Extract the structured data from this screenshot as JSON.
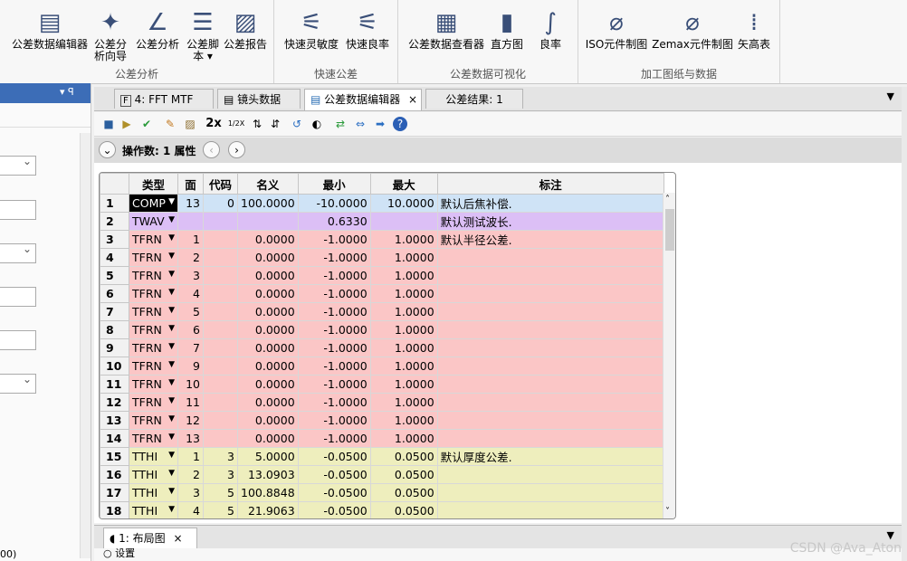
{
  "ribbon": {
    "groups": [
      {
        "label": "公差分析",
        "buttons": [
          "公差数据编辑器",
          "公差分析向导",
          "公差分析",
          "公差脚本 ▾",
          "公差报告"
        ],
        "icons": [
          "tolerance-editor-icon",
          "wizard-icon",
          "analysis-icon",
          "script-icon",
          "report-icon"
        ]
      },
      {
        "label": "快速公差",
        "buttons": [
          "快速灵敏度",
          "快速良率"
        ],
        "icons": [
          "quick-sensitivity-icon",
          "quick-yield-icon"
        ]
      },
      {
        "label": "公差数据可视化",
        "buttons": [
          "公差数据查看器",
          "直方图",
          "良率"
        ],
        "icons": [
          "data-viewer-icon",
          "histogram-icon",
          "yield-curve-icon"
        ]
      },
      {
        "label": "加工图纸与数据",
        "buttons": [
          "ISO元件制图",
          "Zemax元件制图",
          "矢高表"
        ],
        "icons": [
          "iso-drawing-icon",
          "zemax-drawing-icon",
          "sag-table-icon"
        ]
      }
    ]
  },
  "left_panel": {
    "pin_glyph": "▾ ꟼ",
    "status_text": "00)"
  },
  "tabs": [
    {
      "label": "4: FFT MTF",
      "icon": "F"
    },
    {
      "label": "镜头数据",
      "icon": "▤"
    },
    {
      "label": "公差数据编辑器",
      "icon": "▤",
      "active": true,
      "close": "×"
    },
    {
      "label": "公差结果: 1"
    }
  ],
  "toolbar": {
    "zoom_2x": "2x",
    "zoom_half": "1/2X"
  },
  "operand_bar": {
    "label": "操作数: 1 属性",
    "prev": "‹",
    "next": "›",
    "collapse": "⌄"
  },
  "table": {
    "headers": [
      "",
      "类型",
      "面",
      "代码",
      "名义",
      "最小",
      "最大",
      "标注"
    ],
    "rows": [
      {
        "n": "1",
        "type": "COMP",
        "surf": "13",
        "code": "0",
        "nominal": "100.0000",
        "min": "-10.0000",
        "max": "10.0000",
        "comment": "默认后焦补偿.",
        "color": "rb",
        "sel": true
      },
      {
        "n": "2",
        "type": "TWAV",
        "surf": "",
        "code": "",
        "nominal": "",
        "min": "0.6330",
        "max": "",
        "comment": "默认测试波长.",
        "color": "rp"
      },
      {
        "n": "3",
        "type": "TFRN",
        "surf": "1",
        "code": "",
        "nominal": "0.0000",
        "min": "-1.0000",
        "max": "1.0000",
        "comment": "默认半径公差.",
        "color": "rr"
      },
      {
        "n": "4",
        "type": "TFRN",
        "surf": "2",
        "code": "",
        "nominal": "0.0000",
        "min": "-1.0000",
        "max": "1.0000",
        "comment": "",
        "color": "rr"
      },
      {
        "n": "5",
        "type": "TFRN",
        "surf": "3",
        "code": "",
        "nominal": "0.0000",
        "min": "-1.0000",
        "max": "1.0000",
        "comment": "",
        "color": "rr"
      },
      {
        "n": "6",
        "type": "TFRN",
        "surf": "4",
        "code": "",
        "nominal": "0.0000",
        "min": "-1.0000",
        "max": "1.0000",
        "comment": "",
        "color": "rr"
      },
      {
        "n": "7",
        "type": "TFRN",
        "surf": "5",
        "code": "",
        "nominal": "0.0000",
        "min": "-1.0000",
        "max": "1.0000",
        "comment": "",
        "color": "rr"
      },
      {
        "n": "8",
        "type": "TFRN",
        "surf": "6",
        "code": "",
        "nominal": "0.0000",
        "min": "-1.0000",
        "max": "1.0000",
        "comment": "",
        "color": "rr"
      },
      {
        "n": "9",
        "type": "TFRN",
        "surf": "7",
        "code": "",
        "nominal": "0.0000",
        "min": "-1.0000",
        "max": "1.0000",
        "comment": "",
        "color": "rr"
      },
      {
        "n": "10",
        "type": "TFRN",
        "surf": "9",
        "code": "",
        "nominal": "0.0000",
        "min": "-1.0000",
        "max": "1.0000",
        "comment": "",
        "color": "rr"
      },
      {
        "n": "11",
        "type": "TFRN",
        "surf": "10",
        "code": "",
        "nominal": "0.0000",
        "min": "-1.0000",
        "max": "1.0000",
        "comment": "",
        "color": "rr"
      },
      {
        "n": "12",
        "type": "TFRN",
        "surf": "11",
        "code": "",
        "nominal": "0.0000",
        "min": "-1.0000",
        "max": "1.0000",
        "comment": "",
        "color": "rr"
      },
      {
        "n": "13",
        "type": "TFRN",
        "surf": "12",
        "code": "",
        "nominal": "0.0000",
        "min": "-1.0000",
        "max": "1.0000",
        "comment": "",
        "color": "rr"
      },
      {
        "n": "14",
        "type": "TFRN",
        "surf": "13",
        "code": "",
        "nominal": "0.0000",
        "min": "-1.0000",
        "max": "1.0000",
        "comment": "",
        "color": "rr"
      },
      {
        "n": "15",
        "type": "TTHI",
        "surf": "1",
        "code": "3",
        "nominal": "5.0000",
        "min": "-0.0500",
        "max": "0.0500",
        "comment": "默认厚度公差.",
        "color": "ry"
      },
      {
        "n": "16",
        "type": "TTHI",
        "surf": "2",
        "code": "3",
        "nominal": "13.0903",
        "min": "-0.0500",
        "max": "0.0500",
        "comment": "",
        "color": "ry"
      },
      {
        "n": "17",
        "type": "TTHI",
        "surf": "3",
        "code": "5",
        "nominal": "100.8848",
        "min": "-0.0500",
        "max": "0.0500",
        "comment": "",
        "color": "ry"
      },
      {
        "n": "18",
        "type": "TTHI",
        "surf": "4",
        "code": "5",
        "nominal": "21.9063",
        "min": "-0.0500",
        "max": "0.0500",
        "comment": "",
        "color": "ry"
      }
    ]
  },
  "bottom_tabs": [
    {
      "label": "1: 布局图",
      "close": "×"
    }
  ],
  "bottom_toolbar": {
    "settings_label": "设置"
  },
  "watermark": "CSDN @Ava_Aton",
  "colors": {
    "comp": "#cfe3f6",
    "twav": "#dcbff6",
    "tfrn": "#fbc6c6",
    "tthi": "#eeeebd",
    "title_bar": "#3c6db7"
  }
}
